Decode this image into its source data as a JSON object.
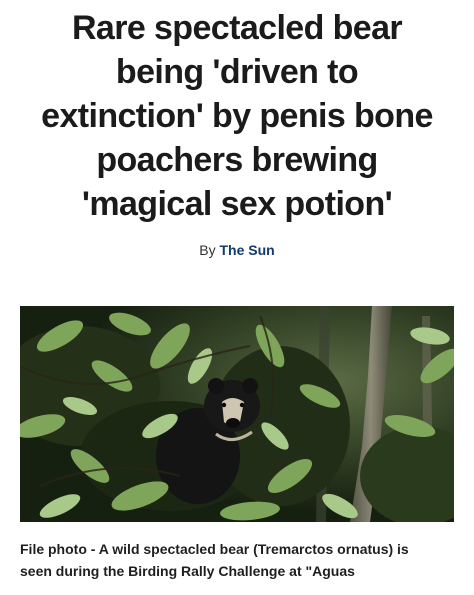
{
  "article": {
    "headline_lines": [
      "Rare spectacled bear",
      "being 'driven to",
      "extinction' by penis bone",
      "poachers brewing",
      "'magical sex potion'"
    ],
    "byline": {
      "prefix": "By",
      "author": "The Sun"
    },
    "image": {
      "subject": "spectacled-bear-in-foliage"
    },
    "caption_lines": [
      "File photo - A wild spectacled bear (Tremarctos ornatus) is",
      "seen during the Birding Rally Challenge at \"Aguas"
    ]
  },
  "colors": {
    "headline": "#1b1b1b",
    "author_link": "#123a6e",
    "foliage_dark": "#1e2a16",
    "foliage_light": "#a9c98a"
  }
}
